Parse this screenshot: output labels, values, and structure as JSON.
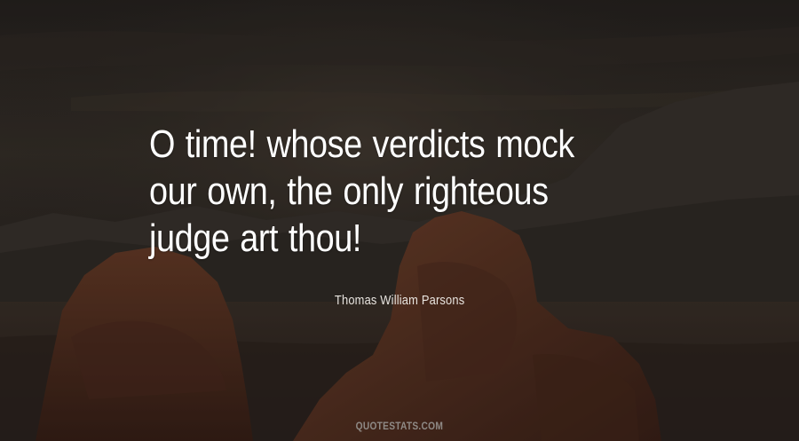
{
  "quote": {
    "text": "O time! whose verdicts mock our own, the only righteous judge art thou!",
    "author": "Thomas William Parsons"
  },
  "brand": {
    "label": "QUOTESTATS.COM"
  },
  "colors": {
    "text": "#ffffff",
    "author": "#e8e4df",
    "brand": "#8f8a86",
    "sky": "#2a2622",
    "rock": "#5a3324"
  }
}
